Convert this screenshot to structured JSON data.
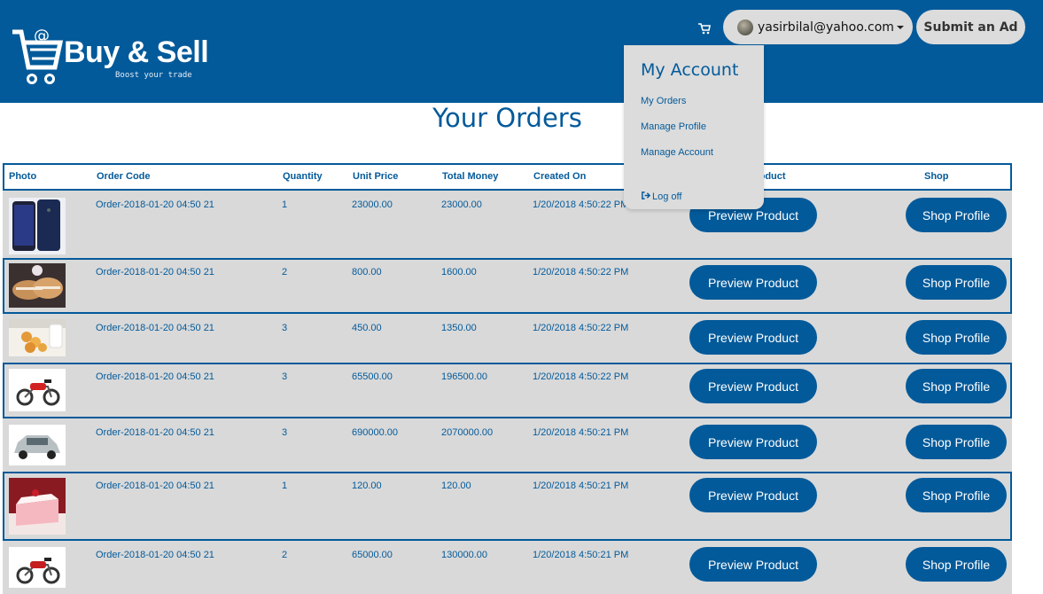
{
  "header": {
    "logo_text": "Buy & Sell",
    "logo_tagline": "Boost your trade",
    "user_email": "yasirbilal@yahoo.com",
    "submit_label": "Submit an Ad",
    "bg_color": "#035a9a"
  },
  "dropdown": {
    "title": "My Account",
    "items": [
      "My Orders",
      "Manage Profile",
      "Manage Account"
    ],
    "logoff": "Log off"
  },
  "page": {
    "title": "Your Orders"
  },
  "table": {
    "headers": [
      "Photo",
      "Order Code",
      "Quantity",
      "Unit Price",
      "Total Money",
      "Created On",
      "Product",
      "Shop"
    ],
    "preview_label": "Preview Product",
    "shop_label": "Shop Profile",
    "rows": [
      {
        "photo": "phone-image",
        "code": "Order-2018-01-20 04:50 21",
        "qty": "1",
        "unit": "23000.00",
        "total": "23000.00",
        "created": "1/20/2018 4:50:22 PM"
      },
      {
        "photo": "cookies-image",
        "code": "Order-2018-01-20 04:50 21",
        "qty": "2",
        "unit": "800.00",
        "total": "1600.00",
        "created": "1/20/2018 4:50:22 PM"
      },
      {
        "photo": "snacks-image",
        "code": "Order-2018-01-20 04:50 21",
        "qty": "3",
        "unit": "450.00",
        "total": "1350.00",
        "created": "1/20/2018 4:50:22 PM"
      },
      {
        "photo": "motorbike-image",
        "code": "Order-2018-01-20 04:50 21",
        "qty": "3",
        "unit": "65500.00",
        "total": "196500.00",
        "created": "1/20/2018 4:50:22 PM"
      },
      {
        "photo": "car-image",
        "code": "Order-2018-01-20 04:50 21",
        "qty": "3",
        "unit": "690000.00",
        "total": "2070000.00",
        "created": "1/20/2018 4:50:21 PM"
      },
      {
        "photo": "cake-image",
        "code": "Order-2018-01-20 04:50 21",
        "qty": "1",
        "unit": "120.00",
        "total": "120.00",
        "created": "1/20/2018 4:50:21 PM"
      },
      {
        "photo": "motorbike-image",
        "code": "Order-2018-01-20 04:50 21",
        "qty": "2",
        "unit": "65000.00",
        "total": "130000.00",
        "created": "1/20/2018 4:50:21 PM"
      }
    ]
  }
}
